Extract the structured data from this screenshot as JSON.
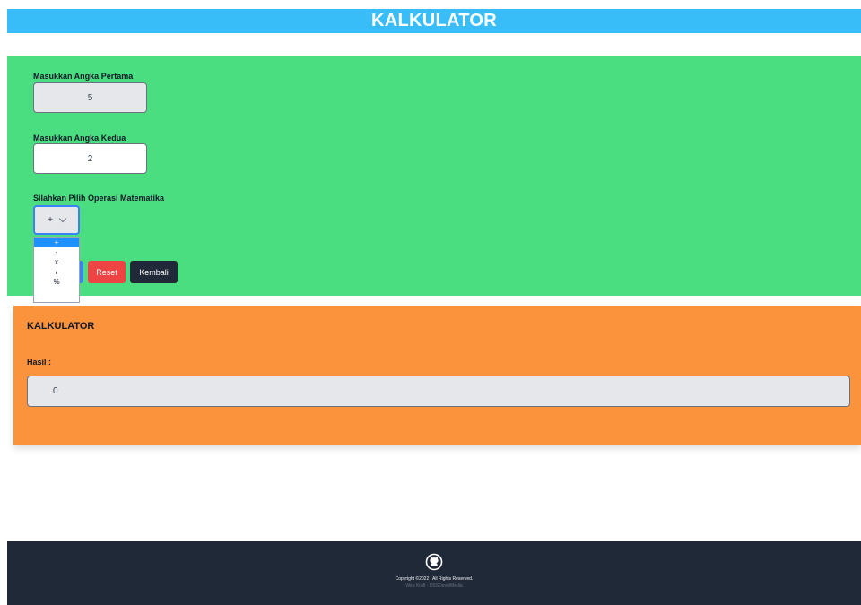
{
  "header": {
    "title": "KALKULATOR"
  },
  "form": {
    "first_label": "Masukkan Angka Pertama",
    "first_value": "5",
    "second_label": "Masukkan Angka Kedua",
    "second_value": "2",
    "operation_label": "Silahkan Pilih Operasi Matematika",
    "operation_selected": "+",
    "operation_options": [
      "+",
      "-",
      "x",
      "/",
      "%"
    ],
    "reset_label": "Reset",
    "back_label": "Kembali"
  },
  "result_card": {
    "title": "KALKULATOR",
    "result_label": "Hasil :",
    "result_value": "0"
  },
  "footer": {
    "copyright": "Copyright ©2022 | All Rights Reserved.",
    "credit": "Web Kraft - DSSDevelMedia"
  },
  "colors": {
    "header_bg": "#38bdf8",
    "form_bg": "#4ade80",
    "result_bg": "#fb923c",
    "footer_bg": "#1f2937",
    "reset_button": "#ef4444",
    "back_button": "#1f2937",
    "submit_button": "#3b82f6"
  },
  "icons": {
    "footer_icon": "github-icon",
    "select_icon": "chevron-down-icon"
  }
}
